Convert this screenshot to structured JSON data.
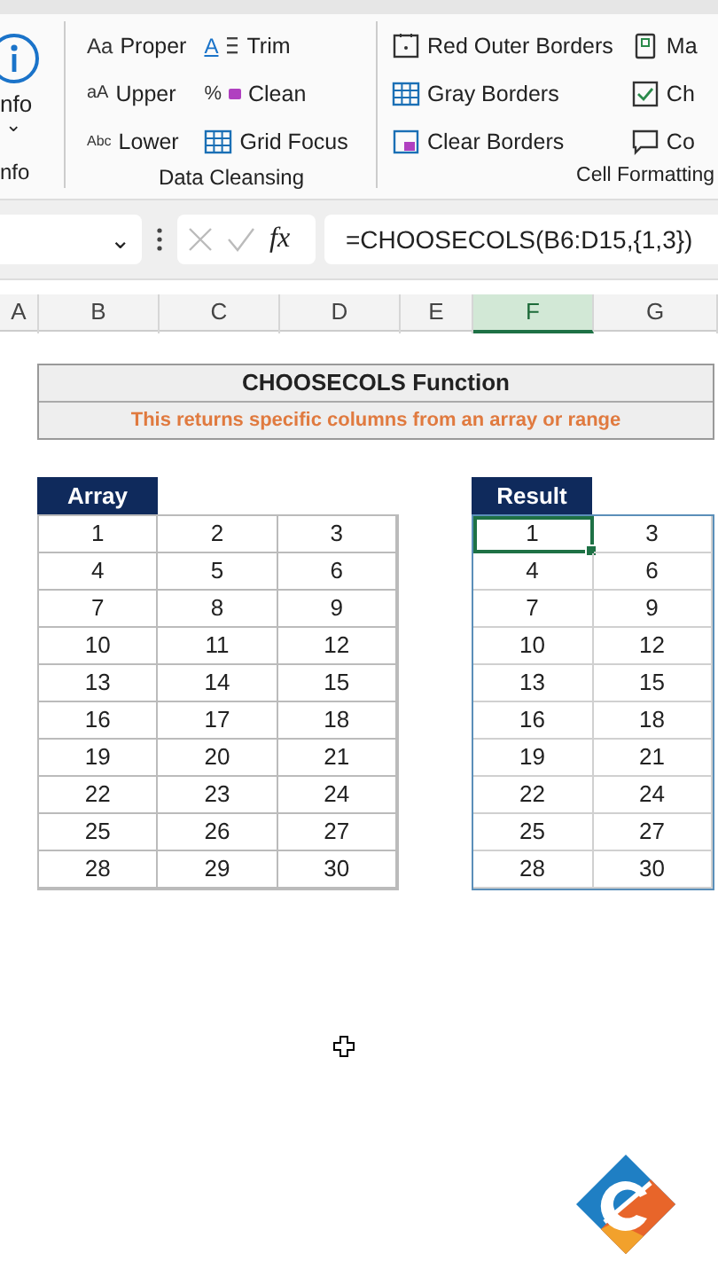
{
  "ribbon": {
    "groups": [
      {
        "label": "nfo",
        "kind": "info",
        "caption": "nfo",
        "caret": "⌄"
      },
      {
        "label": "Data Cleansing",
        "kind": "commands",
        "columns": [
          [
            {
              "label": "Proper",
              "glyph": "Aa"
            },
            {
              "label": "Upper",
              "glyph": "aA"
            },
            {
              "label": "Lower",
              "glyph": "Abc"
            }
          ],
          [
            {
              "label": "Trim",
              "glyph": "A"
            },
            {
              "label": "Clean",
              "glyph": "%"
            },
            {
              "label": "Grid Focus"
            }
          ]
        ]
      },
      {
        "label": "Cell Formatting",
        "kind": "commands",
        "columns": [
          [
            {
              "label": "Red Outer Borders"
            },
            {
              "label": "Gray Borders"
            },
            {
              "label": "Clear Borders"
            }
          ],
          [
            {
              "label": "Ma"
            },
            {
              "label": "Ch"
            },
            {
              "label": "Co"
            }
          ]
        ]
      }
    ]
  },
  "formula_bar": {
    "name_box_caret": "⌄",
    "fx": "fx",
    "formula": "=CHOOSECOLS(B6:D15,{1,3})"
  },
  "column_headers": [
    {
      "label": "A",
      "selected": false
    },
    {
      "label": "B",
      "selected": false
    },
    {
      "label": "C",
      "selected": false
    },
    {
      "label": "D",
      "selected": false
    },
    {
      "label": "E",
      "selected": false
    },
    {
      "label": "F",
      "selected": true
    },
    {
      "label": "G",
      "selected": false
    }
  ],
  "title": "CHOOSECOLS Function",
  "subtitle": "This returns specific columns from an array or range",
  "array": {
    "header": "Array",
    "rows": [
      [
        "1",
        "2",
        "3"
      ],
      [
        "4",
        "5",
        "6"
      ],
      [
        "7",
        "8",
        "9"
      ],
      [
        "10",
        "11",
        "12"
      ],
      [
        "13",
        "14",
        "15"
      ],
      [
        "16",
        "17",
        "18"
      ],
      [
        "19",
        "20",
        "21"
      ],
      [
        "22",
        "23",
        "24"
      ],
      [
        "25",
        "26",
        "27"
      ],
      [
        "28",
        "29",
        "30"
      ]
    ]
  },
  "result": {
    "header": "Result",
    "rows": [
      {
        "values": [
          "1",
          "3"
        ],
        "selected": true
      },
      {
        "values": [
          "4",
          "6"
        ],
        "selected": false
      },
      {
        "values": [
          "7",
          "9"
        ],
        "selected": false
      },
      {
        "values": [
          "10",
          "12"
        ],
        "selected": false
      },
      {
        "values": [
          "13",
          "15"
        ],
        "selected": false
      },
      {
        "values": [
          "16",
          "18"
        ],
        "selected": false
      },
      {
        "values": [
          "19",
          "21"
        ],
        "selected": false
      },
      {
        "values": [
          "22",
          "24"
        ],
        "selected": false
      },
      {
        "values": [
          "25",
          "27"
        ],
        "selected": false
      },
      {
        "values": [
          "28",
          "30"
        ],
        "selected": false
      }
    ]
  }
}
